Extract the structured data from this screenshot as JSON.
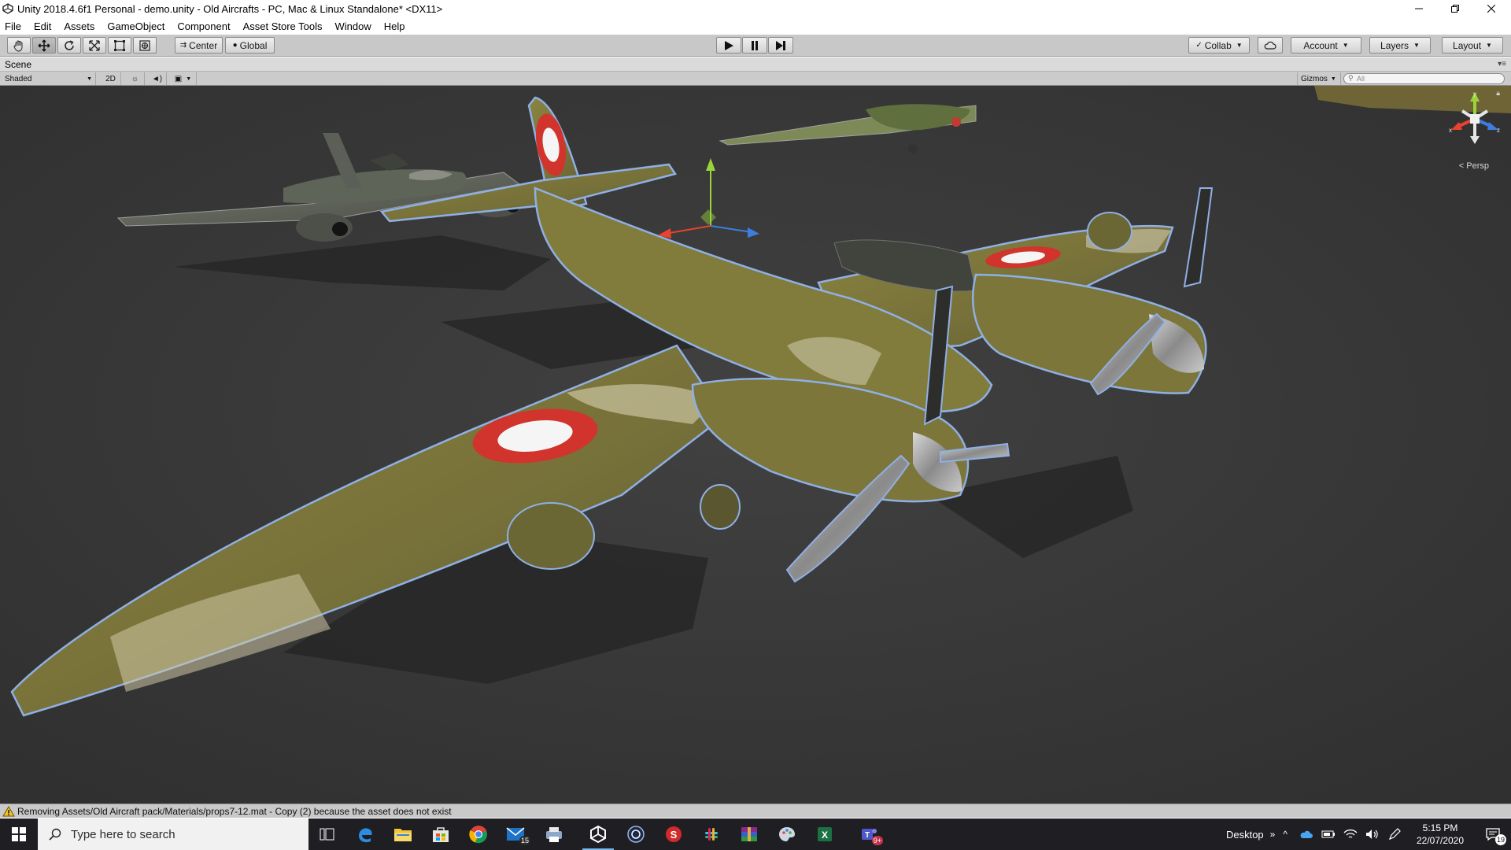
{
  "window": {
    "title": "Unity 2018.4.6f1 Personal - demo.unity - Old Aircrafts - PC, Mac & Linux Standalone* <DX11>"
  },
  "menu": [
    "File",
    "Edit",
    "Assets",
    "GameObject",
    "Component",
    "Asset Store Tools",
    "Window",
    "Help"
  ],
  "toolbar": {
    "pivot_mode": "Center",
    "pivot_rotation": "Global",
    "collab": "Collab",
    "account": "Account",
    "layers": "Layers",
    "layout": "Layout",
    "active_tool": "move"
  },
  "scene": {
    "tab_label": "Scene",
    "shading_mode": "Shaded",
    "mode_2d": "2D",
    "gizmos": "Gizmos",
    "search_placeholder": "All",
    "projection": "Persp",
    "axis_labels": {
      "x": "x",
      "y": "y",
      "z": "z"
    },
    "colors": {
      "background": "#3a3a3a",
      "camo_olive": "#807a3a",
      "camo_light": "#cfc8a6",
      "roundel_outer": "#d0342c",
      "roundel_inner": "#ffffff",
      "selection_outline": "#8fb0e6",
      "axis_x": "#e8432e",
      "axis_y": "#9bd43a",
      "axis_z": "#3d7de0"
    }
  },
  "status": {
    "message": "Removing Assets/Old Aircraft pack/Materials/props7-12.mat - Copy (2) because the asset does not exist"
  },
  "taskbar": {
    "search_placeholder": "Type here to search",
    "apps": [
      {
        "name": "task-view-icon",
        "badge": ""
      },
      {
        "name": "edge-icon",
        "badge": ""
      },
      {
        "name": "file-explorer-icon",
        "badge": ""
      },
      {
        "name": "store-icon",
        "badge": ""
      },
      {
        "name": "chrome-icon",
        "badge": ""
      },
      {
        "name": "mail-icon",
        "badge": "15"
      },
      {
        "name": "printer-app-icon",
        "badge": ""
      },
      {
        "name": "unity-icon",
        "badge": ""
      },
      {
        "name": "cinema-app-icon",
        "badge": ""
      },
      {
        "name": "substance-app-icon",
        "badge": ""
      },
      {
        "name": "slack-icon",
        "badge": ""
      },
      {
        "name": "winrar-icon",
        "badge": ""
      },
      {
        "name": "paint-app-icon",
        "badge": ""
      },
      {
        "name": "excel-icon",
        "badge": ""
      },
      {
        "name": "teams-icon",
        "badge": "9+"
      }
    ],
    "desktop_label": "Desktop",
    "time": "5:15 PM",
    "date": "22/07/2020",
    "notifications": "19"
  }
}
